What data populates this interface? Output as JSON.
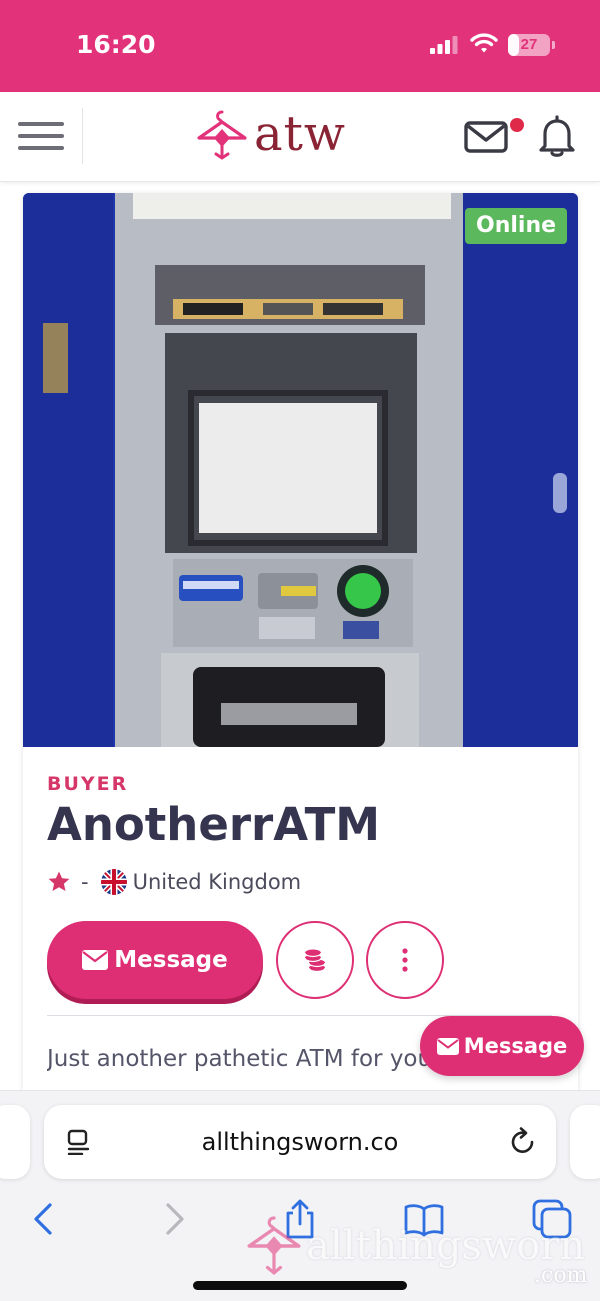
{
  "status_bar": {
    "time": "16:20",
    "battery_level": "27"
  },
  "header": {
    "logo_text": "atw",
    "brand_color": "#e2327a",
    "has_unread_messages": true
  },
  "profile": {
    "online_status": "Online",
    "role": "BUYER",
    "username": "AnotherrATM",
    "rating": "-",
    "country": "United Kingdom",
    "message_button_label": "Message",
    "bio": "Just another pathetic ATM for you to use, you give me the more I send. You deserve it"
  },
  "floating_button": {
    "label": "Message"
  },
  "browser": {
    "url": "allthingsworn.co"
  },
  "watermark": {
    "text": "allthingsworn",
    "suffix": ".com"
  },
  "icons": {
    "menu": "hamburger-menu-icon",
    "mail": "envelope-icon",
    "notifications": "bell-icon",
    "rating": "star-icon",
    "country": "uk-flag-icon",
    "tip": "coins-icon",
    "more": "vertical-dots-icon",
    "reader": "page-menu-icon",
    "reload": "reload-icon",
    "back": "chevron-left-icon",
    "forward": "chevron-right-icon",
    "share": "share-icon",
    "bookmarks": "book-icon",
    "tabs": "tabs-icon"
  }
}
